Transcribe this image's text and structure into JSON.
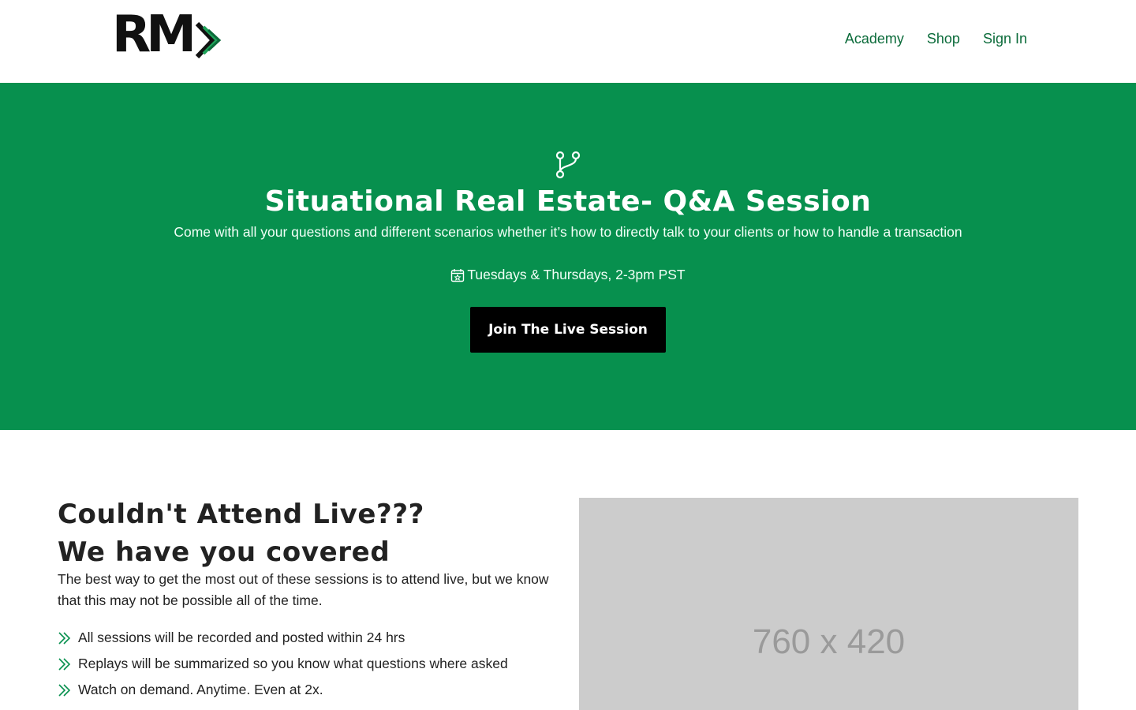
{
  "header": {
    "logo_text": "RM",
    "nav": [
      {
        "label": "Academy"
      },
      {
        "label": "Shop"
      },
      {
        "label": "Sign In"
      }
    ]
  },
  "hero": {
    "icon": "git-branch-icon",
    "title": "Situational Real Estate- Q&A Session",
    "subtitle": "Come with all your questions and different scenarios whether it’s how to directly talk to your clients or how to handle a transaction",
    "schedule_icon": "calendar-star-icon",
    "schedule": "Tuesdays & Thursdays, 2-3pm PST",
    "cta_label": "Join The Live Session"
  },
  "replay": {
    "title_line1": "Couldn't Attend Live???",
    "title_line2": "We have you covered",
    "description": "The best way to get the most out of these sessions is to attend live, but we know that this may not be possible all of the time.",
    "bullet_icon": "double-chevron-right-icon",
    "bullets": [
      "All sessions will be recorded and posted within 24 hrs",
      "Replays will be summarized so you know what questions where asked",
      "Watch on demand. Anytime. Even at 2x."
    ],
    "image_placeholder_text": "760 x 420"
  },
  "colors": {
    "brand_green": "#07904e",
    "nav_green": "#0b6b3a",
    "cta_bg": "#000000",
    "placeholder_bg": "#cccccc"
  }
}
